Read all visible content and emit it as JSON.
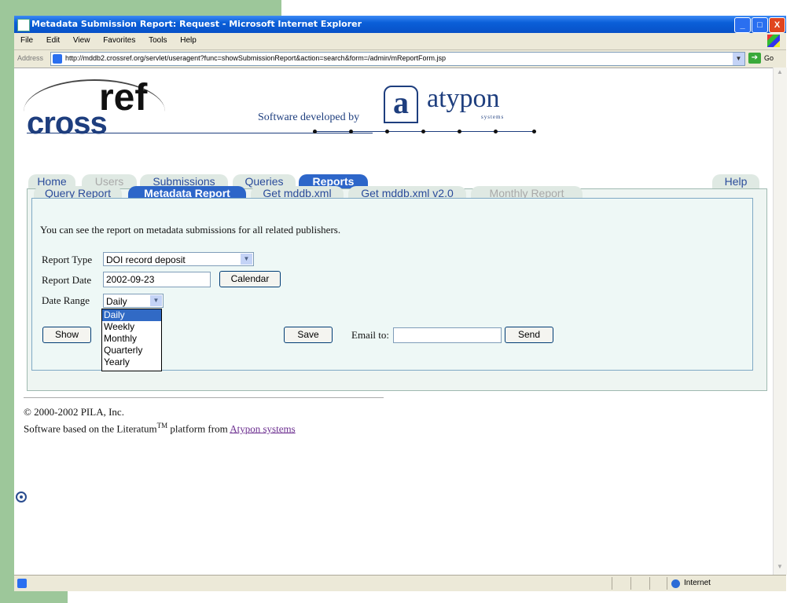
{
  "window": {
    "title": "Metadata Submission Report: Request - Microsoft Internet Explorer",
    "buttons": {
      "minimize": "_",
      "maximize": "□",
      "close": "X"
    }
  },
  "menu": [
    "File",
    "Edit",
    "View",
    "Favorites",
    "Tools",
    "Help"
  ],
  "address": {
    "label": "Address",
    "url": "http://mddb2.crossref.org/servlet/useragent?func=showSubmissionReport&action=search&form=/admin/mReportForm.jsp",
    "go_label": "Go"
  },
  "logo": {
    "cross": "cross",
    "ref": "ref",
    "software_by": "Software developed by",
    "atypon_letter": "a",
    "atypon_word": "atypon",
    "atypon_sub": "systems"
  },
  "tabs": [
    {
      "label": "Home",
      "state": "light"
    },
    {
      "label": "Users",
      "state": "gray"
    },
    {
      "label": "Submissions",
      "state": "light"
    },
    {
      "label": "Queries",
      "state": "light"
    },
    {
      "label": "Reports",
      "state": "active"
    },
    {
      "label": "Help",
      "state": "light"
    }
  ],
  "subtabs": [
    {
      "label": "Query Report",
      "state": "light"
    },
    {
      "label": "Metadata Report",
      "state": "active"
    },
    {
      "label": "Get mddb.xml",
      "state": "light"
    },
    {
      "label": "Get mddb.xml v2.0",
      "state": "light"
    },
    {
      "label": "Monthly Report",
      "state": "gray"
    }
  ],
  "form": {
    "intro": "You can see the report on metadata submissions for all related publishers.",
    "report_type_label": "Report Type",
    "report_type_value": "DOI record deposit",
    "report_date_label": "Report Date",
    "report_date_value": "2002-09-23",
    "calendar_label": "Calendar",
    "date_range_label": "Date Range",
    "date_range_value": "Daily",
    "date_range_options": [
      "Daily",
      "Weekly",
      "Monthly",
      "Quarterly",
      "Yearly"
    ],
    "show_label": "Show",
    "save_label": "Save",
    "email_label": "Email to:",
    "email_value": "",
    "send_label": "Send"
  },
  "footer": {
    "copyright": "© 2000-2002 PILA, Inc.",
    "based_prefix": "Software based on the Literatum",
    "tm": "TM",
    "based_middle": " platform from ",
    "link": "Atypon systems"
  },
  "status": {
    "zone": "Internet"
  },
  "colors": {
    "green_background": "#9dc79a",
    "tab_active": "#2d66c9",
    "panel_bg": "#eef8f6"
  }
}
